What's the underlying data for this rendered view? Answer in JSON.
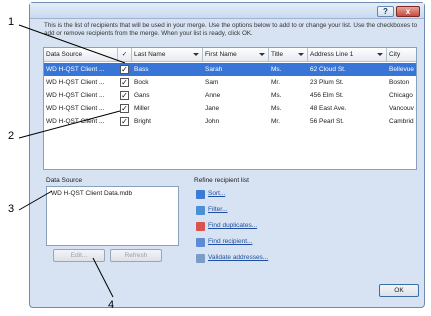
{
  "dialog": {
    "help_label": "?",
    "close_label": "x",
    "intro_text": "This is the list of recipients that will be used in your merge. Use the options below to add to or change your list. Use the checkboxes to add or remove recipients from the merge. When your list is ready, click OK."
  },
  "table": {
    "headers": {
      "data_source": "Data Source",
      "check": "✓",
      "last_name": "Last Name",
      "first_name": "First Name",
      "title": "Title",
      "address": "Address Line 1",
      "city": "City"
    },
    "rows": [
      {
        "source": "WD H-QST Client ...",
        "checked": "✓",
        "last": "Bass",
        "first": "Sarah",
        "title": "Ms.",
        "address": "62 Cloud St.",
        "city": "Bellevue",
        "selected": true
      },
      {
        "source": "WD H-QST Client ...",
        "checked": "✓",
        "last": "Bock",
        "first": "Sam",
        "title": "Mr.",
        "address": "23 Plum St.",
        "city": "Boston",
        "selected": false
      },
      {
        "source": "WD H-QST Client ...",
        "checked": "✓",
        "last": "Gans",
        "first": "Anne",
        "title": "Ms.",
        "address": "456 Elm St.",
        "city": "Chicago",
        "selected": false
      },
      {
        "source": "WD H-QST Client ...",
        "checked": "✓",
        "last": "Miller",
        "first": "Jane",
        "title": "Ms.",
        "address": "48 East Ave.",
        "city": "Vancouv",
        "selected": false
      },
      {
        "source": "WD H-QST Client ...",
        "checked": "✓",
        "last": "Bright",
        "first": "John",
        "title": "Mr.",
        "address": "56 Pearl St.",
        "city": "Cambrid",
        "selected": false
      }
    ]
  },
  "data_source": {
    "label": "Data Source",
    "items": [
      "WD H-QST Client Data.mdb"
    ]
  },
  "refine": {
    "label": "Refine recipient list",
    "items": [
      {
        "label": "Sort...",
        "icon": "sort-icon",
        "color": "#3a7bd5"
      },
      {
        "label": "Filter...",
        "icon": "filter-icon",
        "color": "#4a90d9"
      },
      {
        "label": "Find duplicates...",
        "icon": "duplicates-icon",
        "color": "#d9534f"
      },
      {
        "label": "Find recipient...",
        "icon": "find-recipient-icon",
        "color": "#5b8dd6"
      },
      {
        "label": "Validate addresses...",
        "icon": "validate-icon",
        "color": "#7a9cc6"
      }
    ]
  },
  "buttons": {
    "edit": "Edit...",
    "refresh": "Refresh",
    "ok": "OK"
  },
  "callouts": {
    "c1": "1",
    "c2": "2",
    "c3": "3",
    "c4": "4"
  },
  "colors": {
    "selection": "#3875d7",
    "dialog_bg": "#d7e3f2",
    "link": "#1f4fa0"
  }
}
